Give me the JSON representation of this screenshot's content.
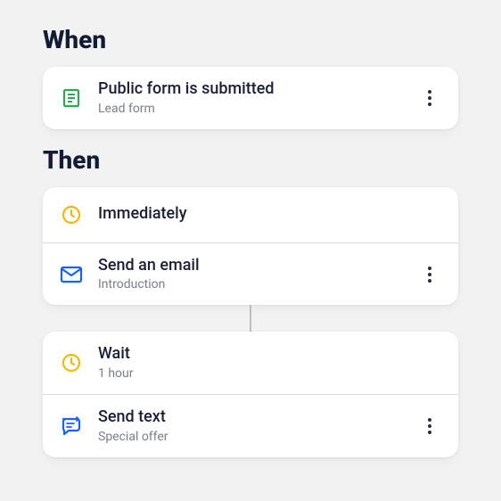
{
  "when": {
    "heading": "When",
    "trigger": {
      "title": "Public form is submitted",
      "subtitle": "Lead form",
      "icon": "form-icon"
    }
  },
  "then": {
    "heading": "Then",
    "groups": [
      {
        "rows": [
          {
            "title_only": "Immediately",
            "icon": "clock-icon"
          },
          {
            "title": "Send an email",
            "subtitle": "Introduction",
            "icon": "email-icon",
            "menu": true
          }
        ]
      },
      {
        "rows": [
          {
            "title": "Wait",
            "subtitle": "1 hour",
            "icon": "clock-icon"
          },
          {
            "title": "Send text",
            "subtitle": "Special offer",
            "icon": "sms-icon",
            "menu": true
          }
        ]
      }
    ]
  }
}
